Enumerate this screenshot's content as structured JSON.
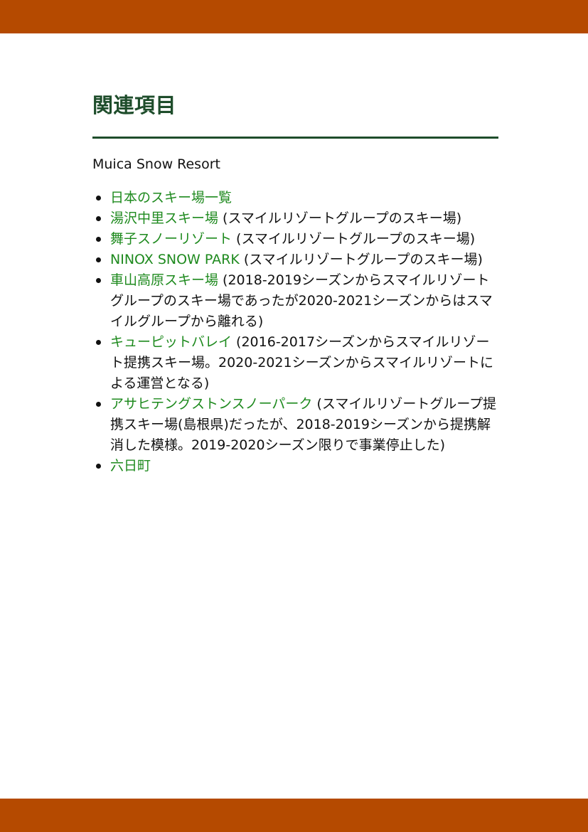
{
  "section": {
    "heading": "関連項目",
    "intro": "Muica Snow Resort"
  },
  "related_items": [
    {
      "link": "日本のスキー場一覧",
      "note": ""
    },
    {
      "link": "湯沢中里スキー場",
      "note": " (スマイルリゾートグループのスキー場)"
    },
    {
      "link": "舞子スノーリゾート",
      "note": " (スマイルリゾートグループのスキー場)"
    },
    {
      "link": "NINOX SNOW PARK",
      "note": " (スマイルリゾートグループのスキー場)"
    },
    {
      "link": "車山高原スキー場",
      "note": " (2018-2019シーズンからスマイルリゾートグループのスキー場であったが2020-2021シーズンからはスマイルグループから離れる)"
    },
    {
      "link": "キューピットバレイ",
      "note": " (2016-2017シーズンからスマイルリゾート提携スキー場。2020-2021シーズンからスマイルリゾートによる運営となる)"
    },
    {
      "link": "アサヒテングストンスノーパーク",
      "note": " (スマイルリゾートグループ提携スキー場(島根県)だったが、2018-2019シーズンから提携解消した模様。2019-2020シーズン限りで事業停止した)"
    },
    {
      "link": "六日町",
      "note": ""
    }
  ],
  "colors": {
    "accent_bar": "#b54a00",
    "heading": "#1e4d2b",
    "link": "#1e8a1e"
  }
}
